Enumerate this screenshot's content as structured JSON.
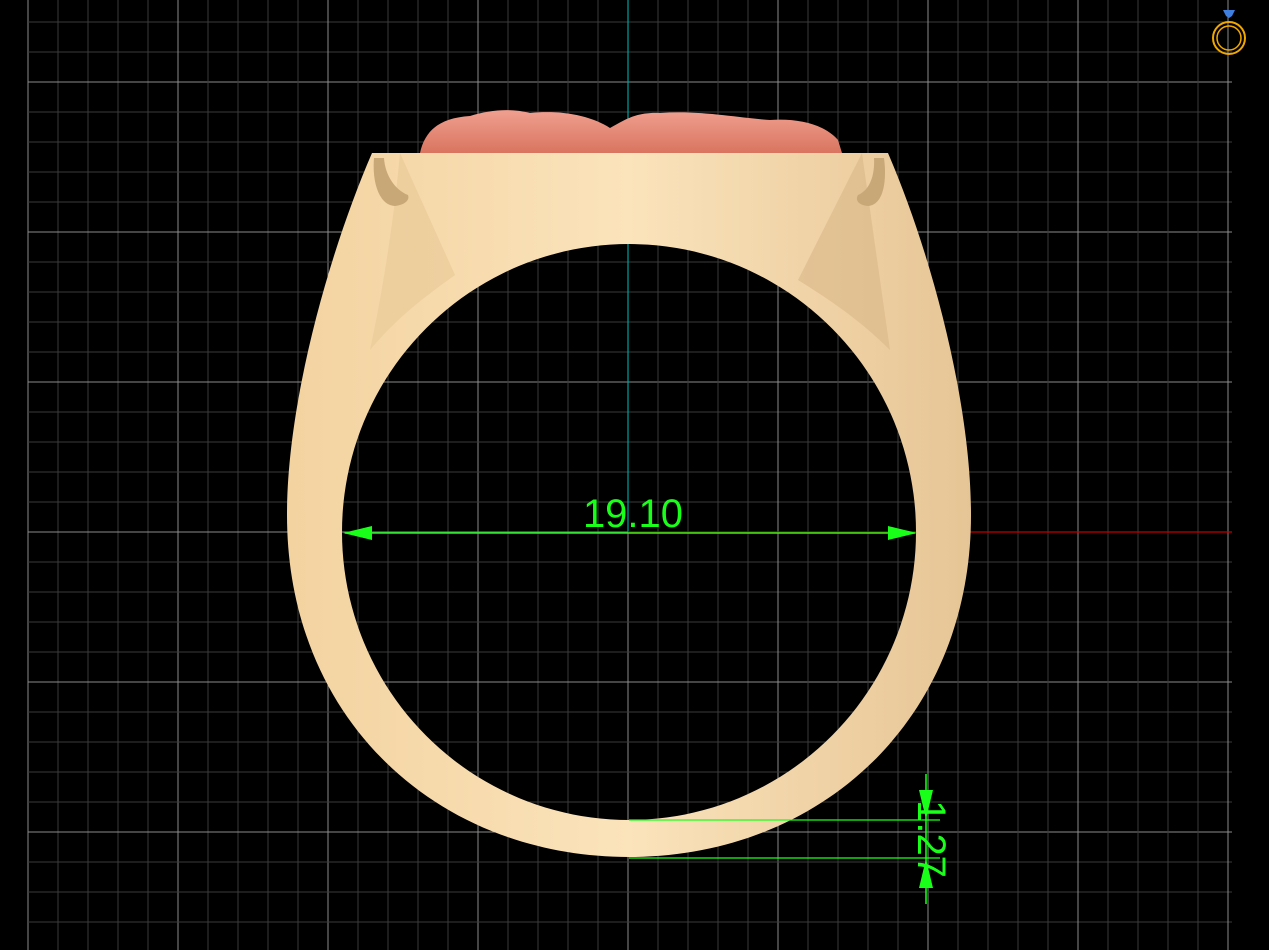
{
  "viewport": {
    "view_cube_icon": "ring-view-icon",
    "dimensions": {
      "inner_diameter": "19.10",
      "shank_thickness": "1.27"
    },
    "colors": {
      "background": "#000000",
      "grid_minor": "#3a3a3a",
      "grid_major": "#8a8a8a",
      "axis_x": "#c00000",
      "axis_y": "#00a0a0",
      "dimension": "#1aff1a",
      "metal": "#f5d6a8",
      "stone_head": "#e98a78"
    }
  }
}
